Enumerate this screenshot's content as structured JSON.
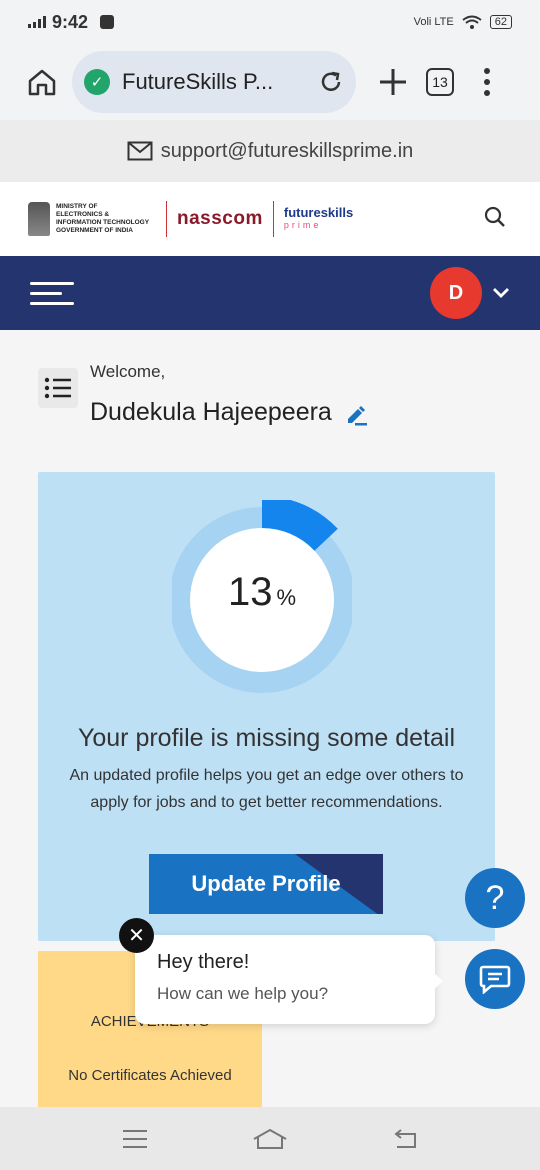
{
  "status_bar": {
    "time": "9:42",
    "network": "Voli LTE",
    "battery": "62"
  },
  "browser": {
    "url_text": "FutureSkills P...",
    "tab_count": "13"
  },
  "support": {
    "email": "support@futureskillsprime.in"
  },
  "logos": {
    "meity_line1": "MINISTRY OF",
    "meity_line2": "ELECTRONICS &",
    "meity_line3": "INFORMATION TECHNOLOGY",
    "meity_line4": "GOVERNMENT OF INDIA",
    "nasscom": "nasscom",
    "fsp_name": "futureskills",
    "fsp_sub": "prime"
  },
  "nav": {
    "avatar_initial": "D"
  },
  "welcome": {
    "label": "Welcome,",
    "name": "Dudekula Hajeepeera"
  },
  "profile_card": {
    "percent": "13",
    "percent_symbol": "%",
    "completion_fraction": 0.13,
    "title": "Your profile is missing some detail",
    "description": "An updated profile helps you get an edge over others to apply for jobs and to get better recommendations.",
    "button_label": "Update Profile"
  },
  "achievements": {
    "title": "ACHIEVEMENTS",
    "empty_text": "No Certificates Achieved"
  },
  "chat": {
    "greeting": "Hey there!",
    "prompt": "How can we help you?",
    "close_symbol": "✕"
  },
  "help": {
    "symbol": "?"
  },
  "colors": {
    "brand_navy": "#24346f",
    "brand_blue": "#1a72c2",
    "card_bg": "#bee0f5",
    "avatar_red": "#e8392e",
    "achievement_bg": "#ffd988"
  }
}
